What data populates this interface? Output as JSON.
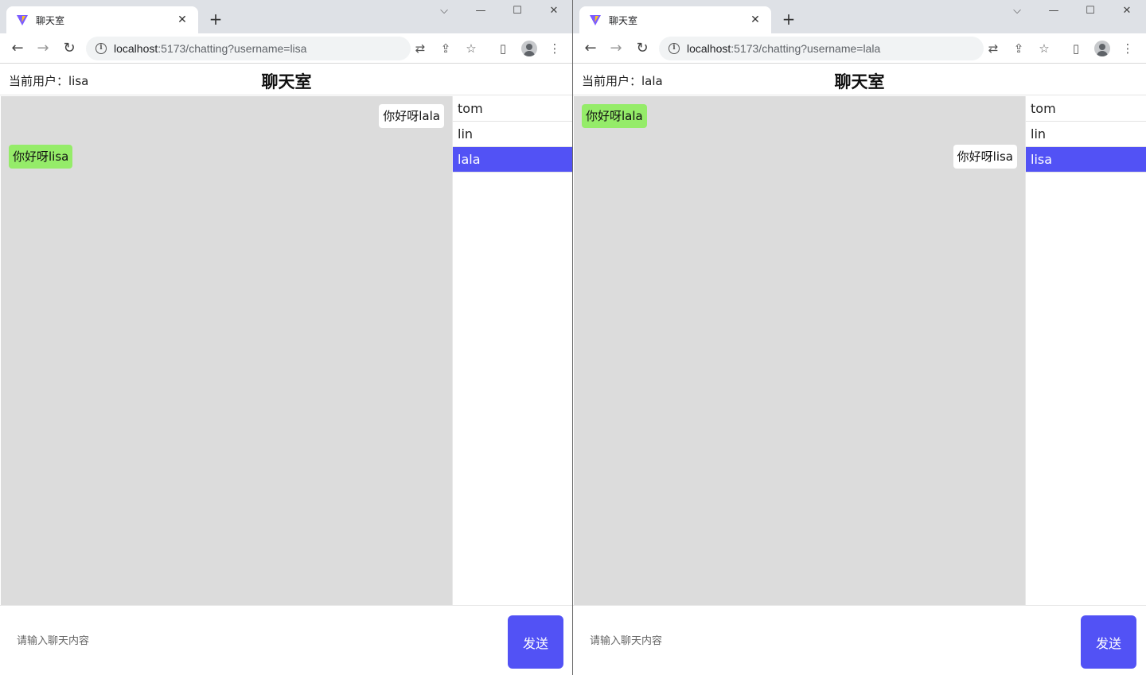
{
  "windows": [
    {
      "tab_title": "聊天室",
      "url_host": "localhost",
      "url_rest": ":5173/chatting?username=lisa",
      "current_user_label": "当前用户：lisa",
      "room_title": "聊天室",
      "messages": [
        {
          "text": "你好呀lala",
          "direction": "sent"
        },
        {
          "text": "你好呀lisa",
          "direction": "received"
        }
      ],
      "users": [
        "tom",
        "lin",
        "lala"
      ],
      "selected_user": "lala",
      "input_placeholder": "请输入聊天内容",
      "send_label": "发送"
    },
    {
      "tab_title": "聊天室",
      "url_host": "localhost",
      "url_rest": ":5173/chatting?username=lala",
      "current_user_label": "当前用户：lala",
      "room_title": "聊天室",
      "messages": [
        {
          "text": "你好呀lala",
          "direction": "received"
        },
        {
          "text": "你好呀lisa",
          "direction": "sent"
        }
      ],
      "users": [
        "tom",
        "lin",
        "lisa"
      ],
      "selected_user": "lisa",
      "input_placeholder": "请输入聊天内容",
      "send_label": "发送"
    }
  ],
  "chrome_icons": {
    "back": "back-arrow-icon",
    "forward": "forward-arrow-icon",
    "reload": "reload-icon",
    "info": "site-info-icon",
    "translate": "translate-icon",
    "share": "share-icon",
    "bookmark": "star-icon",
    "sidepanel": "side-panel-icon",
    "profile": "profile-icon",
    "menu": "kebab-menu-icon"
  },
  "colors": {
    "accent": "#5252f5",
    "received_bubble": "#95ec69",
    "sent_bubble": "#ffffff",
    "message_bg": "#dcdcdc"
  }
}
